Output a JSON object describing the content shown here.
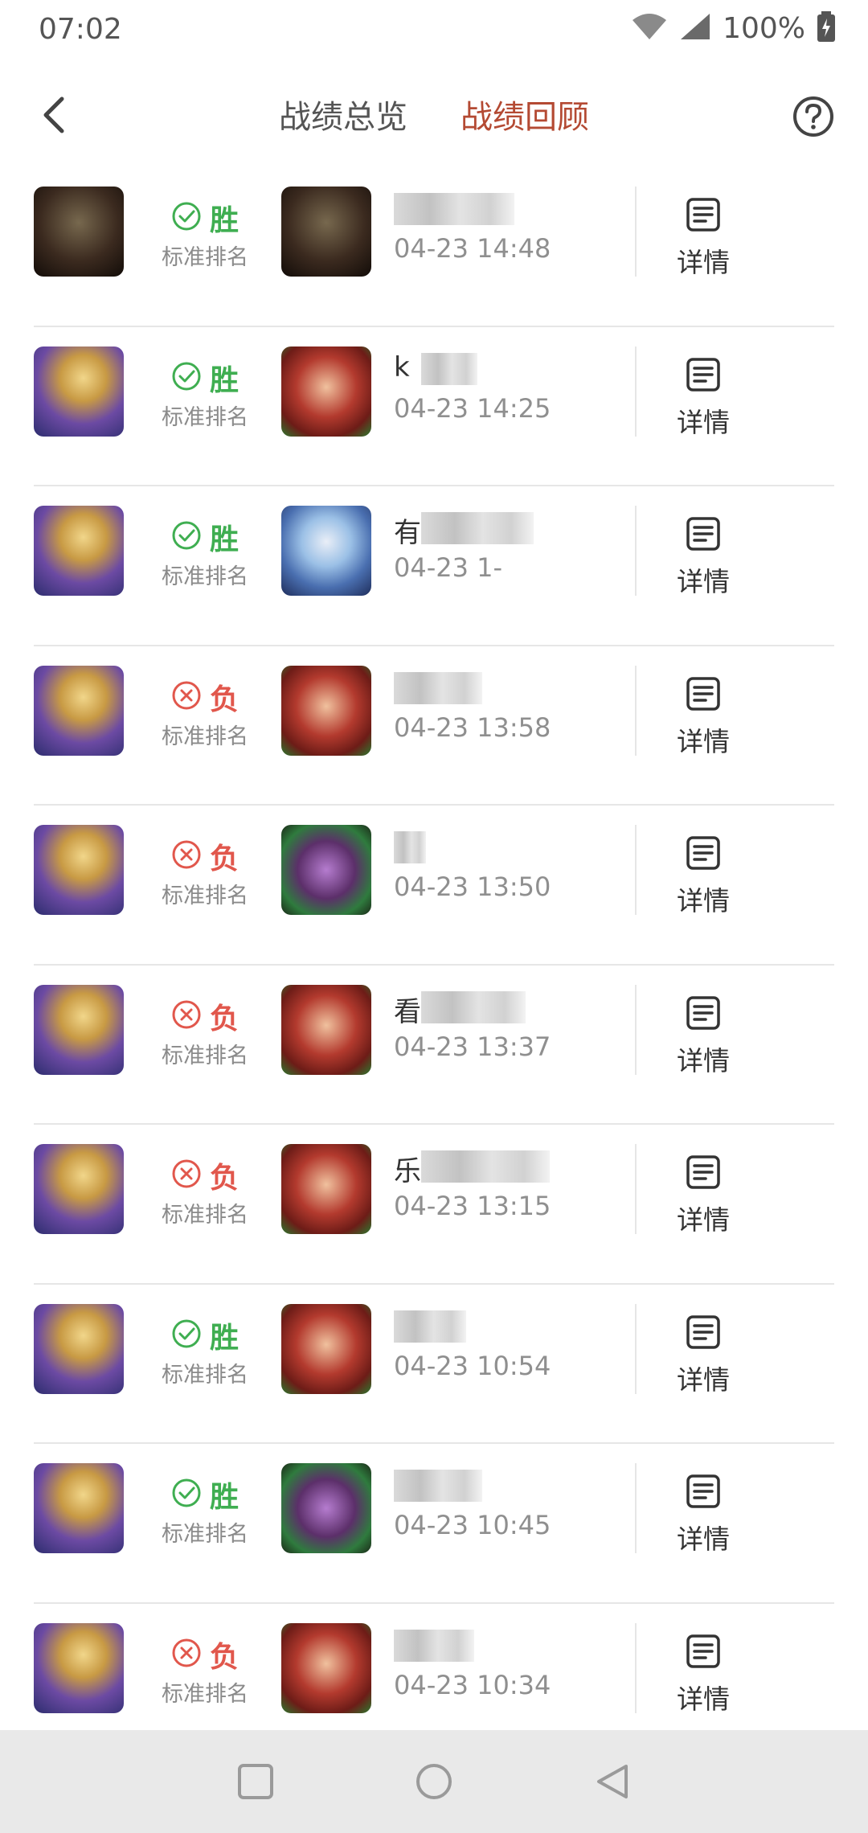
{
  "status_bar": {
    "time": "07:02",
    "battery": "100%"
  },
  "nav": {
    "tabs": [
      {
        "label": "战绩总览",
        "active": false
      },
      {
        "label": "战绩回顾",
        "active": true
      }
    ]
  },
  "colors": {
    "accent": "#b44a33",
    "win": "#3fae51",
    "loss": "#e1574c"
  },
  "matches": [
    {
      "my_hero": "rexxar",
      "result": "胜",
      "outcome": "win",
      "mode": "标准排名",
      "opp_hero": "rexxar",
      "opp_name": "",
      "time": "04-23 14:48",
      "detail": "详情"
    },
    {
      "my_hero": "jaina",
      "result": "胜",
      "outcome": "win",
      "mode": "标准排名",
      "opp_hero": "valeera",
      "opp_name": "k",
      "time": "04-23 14:25",
      "detail": "详情"
    },
    {
      "my_hero": "jaina",
      "result": "胜",
      "outcome": "win",
      "mode": "标准排名",
      "opp_hero": "frost",
      "opp_name": "有",
      "time": "04-23 1-",
      "detail": "详情"
    },
    {
      "my_hero": "jaina",
      "result": "负",
      "outcome": "loss",
      "mode": "标准排名",
      "opp_hero": "valeera",
      "opp_name": "",
      "time": "04-23 13:58",
      "detail": "详情"
    },
    {
      "my_hero": "jaina",
      "result": "负",
      "outcome": "loss",
      "mode": "标准排名",
      "opp_hero": "illidan",
      "opp_name": "",
      "time": "04-23 13:50",
      "detail": "详情"
    },
    {
      "my_hero": "jaina",
      "result": "负",
      "outcome": "loss",
      "mode": "标准排名",
      "opp_hero": "valeera",
      "opp_name": "看",
      "time": "04-23 13:37",
      "detail": "详情"
    },
    {
      "my_hero": "jaina",
      "result": "负",
      "outcome": "loss",
      "mode": "标准排名",
      "opp_hero": "valeera",
      "opp_name": "乐",
      "time": "04-23 13:15",
      "detail": "详情"
    },
    {
      "my_hero": "jaina",
      "result": "胜",
      "outcome": "win",
      "mode": "标准排名",
      "opp_hero": "valeera",
      "opp_name": "",
      "time": "04-23 10:54",
      "detail": "详情"
    },
    {
      "my_hero": "jaina",
      "result": "胜",
      "outcome": "win",
      "mode": "标准排名",
      "opp_hero": "illidan",
      "opp_name": "",
      "time": "04-23 10:45",
      "detail": "详情"
    },
    {
      "my_hero": "jaina",
      "result": "负",
      "outcome": "loss",
      "mode": "标准排名",
      "opp_hero": "valeera",
      "opp_name": "",
      "time": "04-23 10:34",
      "detail": "详情"
    }
  ]
}
